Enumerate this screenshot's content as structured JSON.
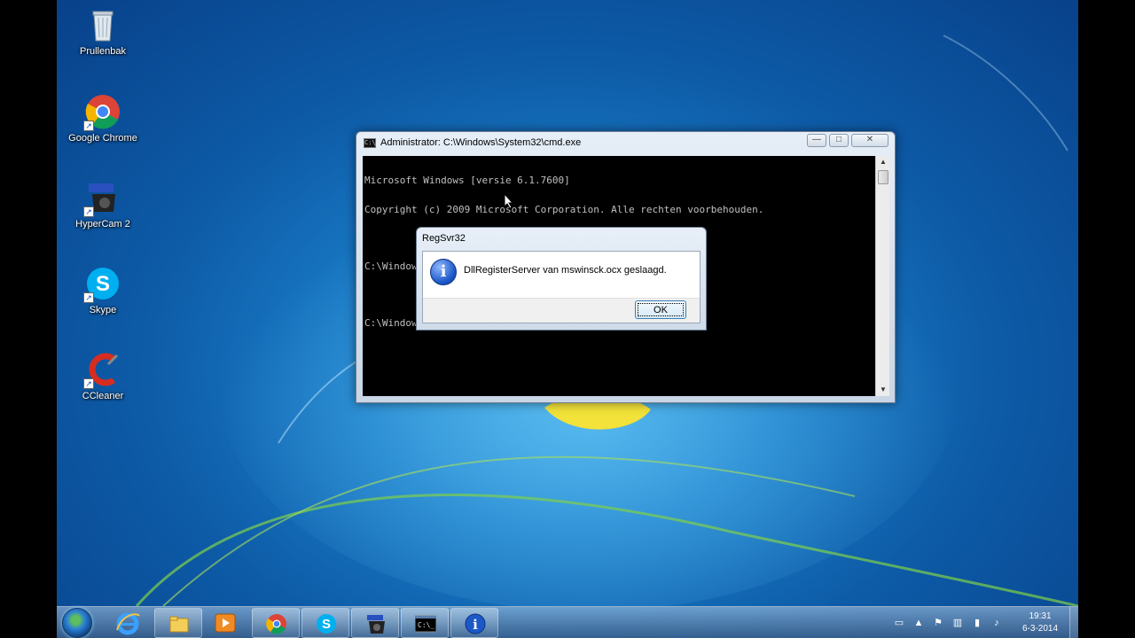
{
  "desktop": {
    "icons": [
      {
        "label": "Prullenbak",
        "icon": "recycle-bin-icon"
      },
      {
        "label": "Google Chrome",
        "icon": "chrome-icon"
      },
      {
        "label": "HyperCam 2",
        "icon": "hypercam-icon"
      },
      {
        "label": "Skype",
        "icon": "skype-icon"
      },
      {
        "label": "CCleaner",
        "icon": "ccleaner-icon"
      }
    ]
  },
  "cmd": {
    "title": "Administrator: C:\\Windows\\System32\\cmd.exe",
    "lines": [
      "Microsoft Windows [versie 6.1.7600]",
      "Copyright (c) 2009 Microsoft Corporation. Alle rechten voorbehouden.",
      "",
      "C:\\Windows\\system32>regsvr32 mswinsck.ocx",
      "",
      "C:\\Windows\\system32>"
    ],
    "minimize": "—",
    "maximize": "□",
    "close": "✕"
  },
  "dialog": {
    "title": "RegSvr32",
    "message": "DllRegisterServer van mswinsck.ocx geslaagd.",
    "ok_label": "OK",
    "icon": "information-icon"
  },
  "taskbar": {
    "items": [
      "internet-explorer-icon",
      "explorer-folder-icon",
      "media-player-icon",
      "chrome-icon",
      "skype-icon",
      "hypercam-icon",
      "cmd-icon",
      "information-icon"
    ],
    "time": "19:31",
    "date": "6-3-2014"
  },
  "colors": {
    "wallpaper": "#0d5aa6",
    "console_bg": "#000000",
    "console_text": "#c0c0c0"
  }
}
